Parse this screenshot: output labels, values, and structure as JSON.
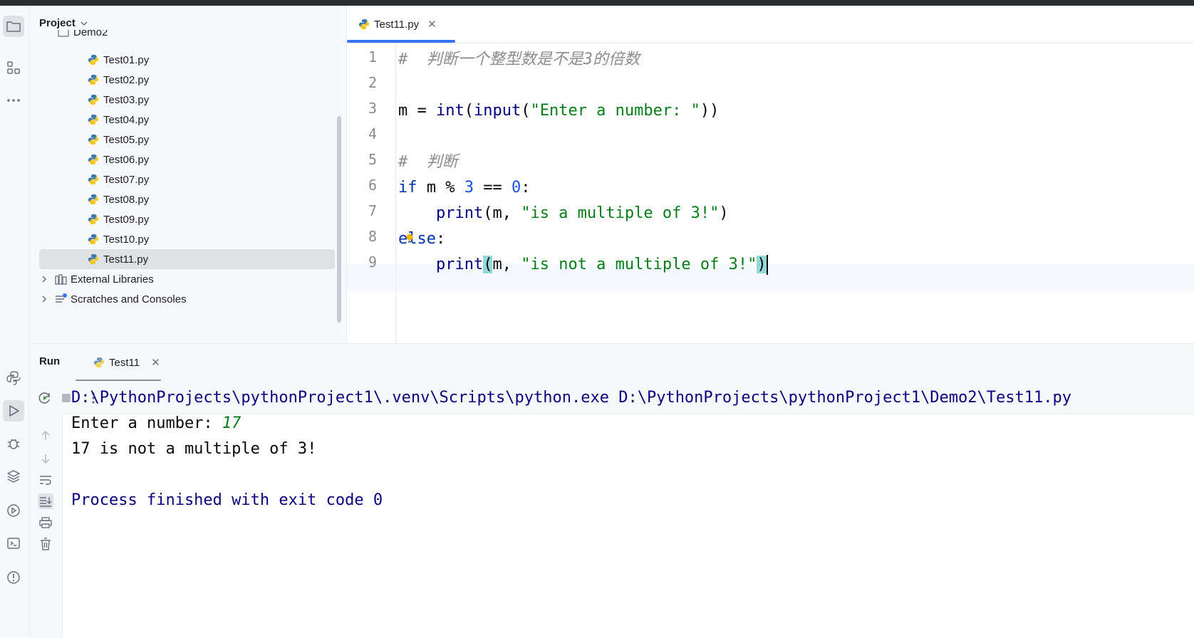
{
  "project": {
    "title": "Project",
    "folder_partial": "Demo2",
    "files": [
      "Test01.py",
      "Test02.py",
      "Test03.py",
      "Test04.py",
      "Test05.py",
      "Test06.py",
      "Test07.py",
      "Test08.py",
      "Test09.py",
      "Test10.py",
      "Test11.py"
    ],
    "selected_file": "Test11.py",
    "external_libraries": "External Libraries",
    "scratches": "Scratches and Consoles"
  },
  "editor": {
    "tab_label": "Test11.py",
    "line_numbers": [
      "1",
      "2",
      "3",
      "4",
      "5",
      "6",
      "7",
      "8",
      "9"
    ],
    "code": {
      "l1_comment": "#  判断一个整型数是不是3的倍数",
      "l3_m": "m = ",
      "l3_int": "int",
      "l3_paren1": "(",
      "l3_input": "input",
      "l3_paren2": "(",
      "l3_str": "\"Enter a number: \"",
      "l3_close": "))",
      "l5_comment": "#  判断",
      "l6_if": "if",
      "l6_mid": " m % ",
      "l6_num3": "3",
      "l6_eq": " == ",
      "l6_num0": "0",
      "l6_colon": ":",
      "l7_indent": "    ",
      "l7_print": "print",
      "l7_args": "(m, ",
      "l7_str": "\"is a multiple of 3!\"",
      "l7_close": ")",
      "l8_else": "else",
      "l8_colon": ":",
      "l9_indent": "    ",
      "l9_print": "print",
      "l9_open": "(",
      "l9_args": "m, ",
      "l9_str": "\"is not a multiple of 3!\"",
      "l9_close": ")"
    }
  },
  "run": {
    "title": "Run",
    "tab_label": "Test11",
    "console": {
      "cmd": "D:\\PythonProjects\\pythonProject1\\.venv\\Scripts\\python.exe D:\\PythonProjects\\pythonProject1\\Demo2\\Test11.py",
      "prompt": "Enter a number: ",
      "input": "17",
      "output": "17 is not a multiple of 3!",
      "exit": "Process finished with exit code 0"
    }
  },
  "colors": {
    "accent": "#3574f0",
    "keyword": "#0033b3",
    "string": "#067d17",
    "number": "#1750eb",
    "comment": "#8c8c8c",
    "console_system": "#0c007f"
  }
}
